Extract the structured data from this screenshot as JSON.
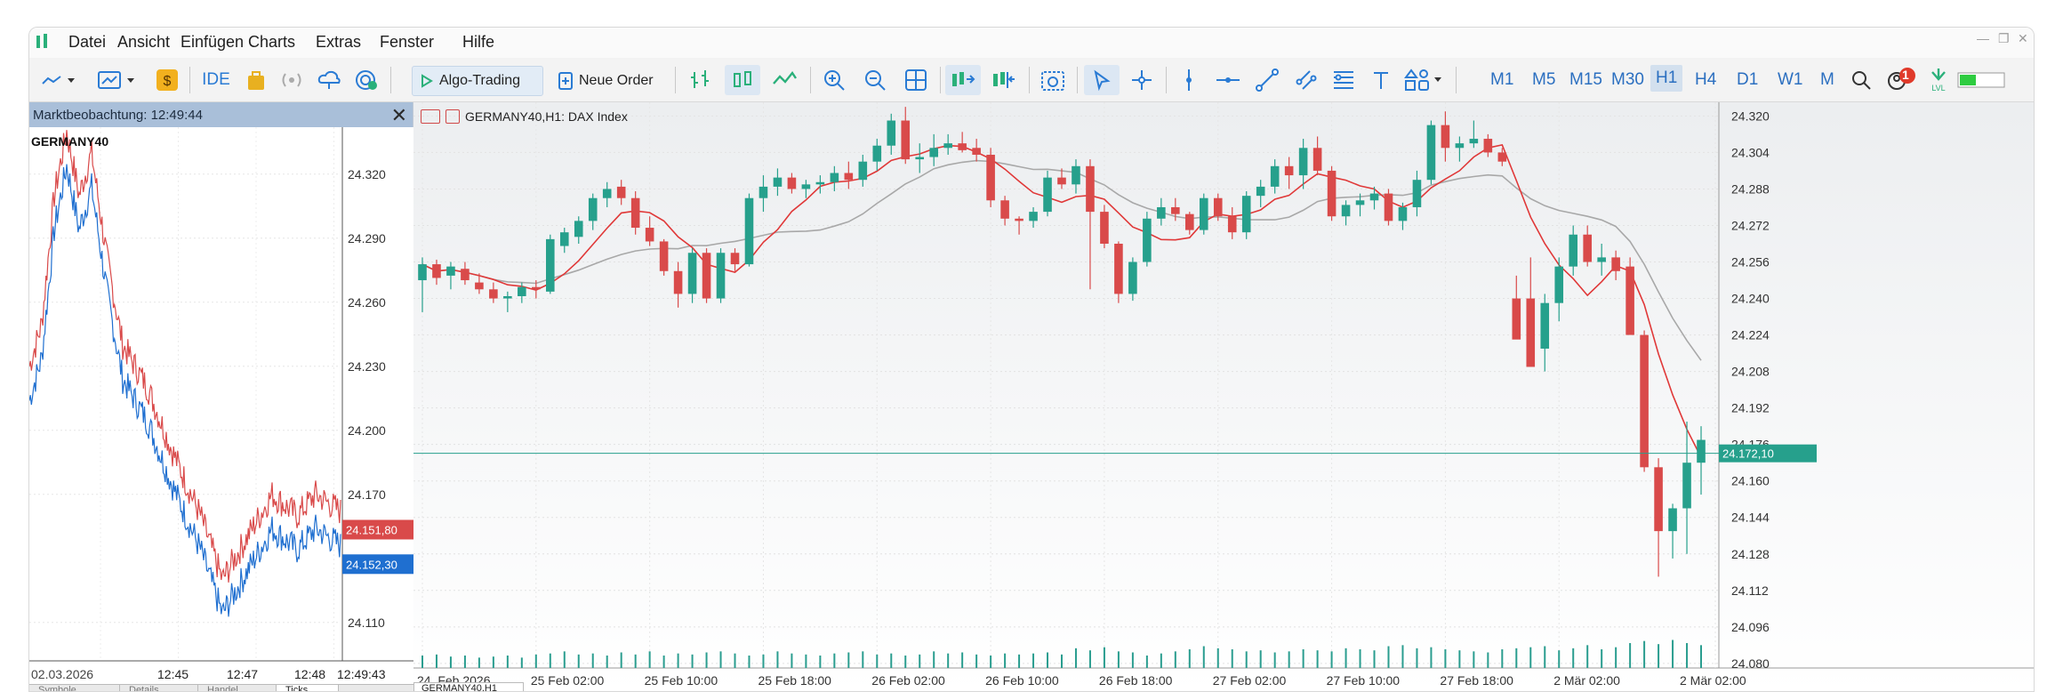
{
  "menu": [
    "Datei",
    "Ansicht",
    "Einfügen",
    "Charts",
    "Extras",
    "Fenster",
    "Hilfe"
  ],
  "toolbar": {
    "ide_label": "IDE",
    "algo_label": "Algo-Trading",
    "order_label": "Neue Order",
    "timeframes": [
      "M1",
      "M5",
      "M15",
      "M30",
      "H1",
      "H4",
      "D1",
      "W1",
      "M"
    ],
    "active_timeframe": "H1",
    "notification_count": "1"
  },
  "market_watch": {
    "title": "Marktbeobachtung: 12:49:44",
    "symbol": "GERMANY40",
    "price_levels": [
      "24.320",
      "24.290",
      "24.260",
      "24.230",
      "24.200",
      "24.170",
      "24.110"
    ],
    "price_values": [
      24320,
      24290,
      24260,
      24230,
      24200,
      24170,
      24110
    ],
    "bid_label": "24.151,80",
    "ask_label": "24.152,30",
    "bid": 24151.8,
    "ask": 24152.3,
    "time_labels": [
      "02.03.2026",
      "12:45",
      "12:47",
      "12:48",
      "12:49:43"
    ],
    "tabs": [
      "Symbole",
      "Details",
      "Handel",
      "Ticks"
    ],
    "colors": {
      "bid": "#d94a4a",
      "ask": "#1f6fd0"
    }
  },
  "chart": {
    "header": "GERMANY40,H1: DAX Index",
    "current_price_label": "24.172,10",
    "current_price": 24172.1,
    "bottom_tab": "GERMANY40,H1",
    "colors": {
      "bull": "#26a08c",
      "bear": "#d94a4a",
      "ma_fast": "#e03838",
      "ma_slow": "#a8a8a8",
      "volume": "#2a9d8f",
      "price_line": "#26a08c"
    }
  },
  "chart_data": {
    "type": "candlestick",
    "yticks": [
      24320,
      24304,
      24288,
      24272,
      24256,
      24240,
      24224,
      24208,
      24192,
      24176,
      24160,
      24144,
      24128,
      24112,
      24096,
      24080
    ],
    "ytick_labels": [
      "24.320",
      "24.304",
      "24.288",
      "24.272",
      "24.256",
      "24.240",
      "24.224",
      "24.208",
      "24.192",
      "24.176",
      "24.160",
      "24.144",
      "24.128",
      "24.112",
      "24.096",
      "24.080"
    ],
    "ylim": [
      24078,
      24326
    ],
    "xtick_labels": [
      "24. Feb 2026",
      "25 Feb 02:00",
      "25 Feb 10:00",
      "25 Feb 18:00",
      "26 Feb 02:00",
      "26 Feb 10:00",
      "26 Feb 18:00",
      "27 Feb 02:00",
      "27 Feb 10:00",
      "27 Feb 18:00",
      "2 Mär 02:00",
      "2 Mär 02:00"
    ],
    "xtick_index": [
      0,
      8,
      16,
      24,
      32,
      40,
      48,
      56,
      64,
      72,
      80,
      91
    ],
    "candles": [
      [
        24248,
        24258,
        24234,
        24255
      ],
      [
        24255,
        24257,
        24246,
        24249
      ],
      [
        24250,
        24256,
        24244,
        24254
      ],
      [
        24253,
        24256,
        24246,
        24248
      ],
      [
        24247,
        24251,
        24242,
        24244
      ],
      [
        24244,
        24247,
        24238,
        24240
      ],
      [
        24240,
        24243,
        24234,
        24241
      ],
      [
        24241,
        24247,
        24238,
        24245
      ],
      [
        24245,
        24248,
        24240,
        24244
      ],
      [
        24243,
        24268,
        24242,
        24266
      ],
      [
        24263,
        24271,
        24260,
        24269
      ],
      [
        24267,
        24276,
        24264,
        24274
      ],
      [
        24274,
        24286,
        24270,
        24284
      ],
      [
        24284,
        24291,
        24280,
        24288
      ],
      [
        24289,
        24292,
        24281,
        24284
      ],
      [
        24284,
        24287,
        24268,
        24271
      ],
      [
        24271,
        24276,
        24263,
        24265
      ],
      [
        24265,
        24266,
        24250,
        24252
      ],
      [
        24252,
        24256,
        24236,
        24242
      ],
      [
        24242,
        24262,
        24238,
        24260
      ],
      [
        24260,
        24262,
        24238,
        24240
      ],
      [
        24240,
        24262,
        24238,
        24260
      ],
      [
        24260,
        24262,
        24252,
        24255
      ],
      [
        24255,
        24286,
        24254,
        24284
      ],
      [
        24284,
        24294,
        24278,
        24289
      ],
      [
        24289,
        24297,
        24285,
        24293
      ],
      [
        24293,
        24295,
        24286,
        24288
      ],
      [
        24288,
        24292,
        24284,
        24290
      ],
      [
        24290,
        24294,
        24286,
        24291
      ],
      [
        24291,
        24298,
        24287,
        24295
      ],
      [
        24295,
        24300,
        24288,
        24292
      ],
      [
        24292,
        24303,
        24289,
        24300
      ],
      [
        24300,
        24310,
        24296,
        24307
      ],
      [
        24307,
        24321,
        24303,
        24318
      ],
      [
        24318,
        24324,
        24299,
        24301
      ],
      [
        24301,
        24308,
        24295,
        24302
      ],
      [
        24302,
        24312,
        24298,
        24306
      ],
      [
        24306,
        24312,
        24303,
        24308
      ],
      [
        24308,
        24313,
        24304,
        24305
      ],
      [
        24306,
        24310,
        24300,
        24303
      ],
      [
        24303,
        24306,
        24280,
        24283
      ],
      [
        24283,
        24285,
        24272,
        24275
      ],
      [
        24275,
        24276,
        24268,
        24274
      ],
      [
        24274,
        24280,
        24271,
        24278
      ],
      [
        24278,
        24296,
        24276,
        24293
      ],
      [
        24293,
        24297,
        24288,
        24290
      ],
      [
        24290,
        24301,
        24286,
        24298
      ],
      [
        24298,
        24301,
        24244,
        24278
      ],
      [
        24278,
        24281,
        24262,
        24264
      ],
      [
        24264,
        24265,
        24238,
        24242
      ],
      [
        24242,
        24258,
        24239,
        24256
      ],
      [
        24256,
        24278,
        24254,
        24275
      ],
      [
        24275,
        24284,
        24272,
        24280
      ],
      [
        24280,
        24284,
        24274,
        24277
      ],
      [
        24277,
        24278,
        24268,
        24270
      ],
      [
        24270,
        24286,
        24268,
        24284
      ],
      [
        24284,
        24286,
        24274,
        24276
      ],
      [
        24276,
        24280,
        24266,
        24269
      ],
      [
        24269,
        24287,
        24266,
        24285
      ],
      [
        24285,
        24292,
        24280,
        24289
      ],
      [
        24289,
        24301,
        24286,
        24298
      ],
      [
        24298,
        24302,
        24288,
        24294
      ],
      [
        24294,
        24310,
        24288,
        24306
      ],
      [
        24306,
        24311,
        24294,
        24296
      ],
      [
        24296,
        24298,
        24274,
        24276
      ],
      [
        24276,
        24283,
        24272,
        24281
      ],
      [
        24281,
        24286,
        24276,
        24283
      ],
      [
        24283,
        24289,
        24279,
        24286
      ],
      [
        24286,
        24288,
        24272,
        24274
      ],
      [
        24274,
        24282,
        24270,
        24280
      ],
      [
        24280,
        24296,
        24276,
        24292
      ],
      [
        24292,
        24318,
        24290,
        24316
      ],
      [
        24316,
        24322,
        24300,
        24306
      ],
      [
        24306,
        24311,
        24300,
        24308
      ],
      [
        24308,
        24318,
        24306,
        24310
      ],
      [
        24310,
        24312,
        24302,
        24304
      ],
      [
        24304,
        24306,
        24298,
        24300
      ],
      [
        24240,
        24250,
        24232,
        24222
      ],
      [
        24240,
        24258,
        24222,
        24210
      ],
      [
        24218,
        24242,
        24208,
        24238
      ],
      [
        24238,
        24258,
        24230,
        24254
      ],
      [
        24254,
        24272,
        24250,
        24268
      ],
      [
        24268,
        24272,
        24254,
        24256
      ],
      [
        24256,
        24264,
        24250,
        24258
      ],
      [
        24258,
        24261,
        24248,
        24252
      ],
      [
        24254,
        24258,
        24244,
        24224
      ],
      [
        24224,
        24226,
        24164,
        24166
      ],
      [
        24166,
        24170,
        24118,
        24138
      ],
      [
        24138,
        24150,
        24126,
        24148
      ],
      [
        24148,
        24186,
        24128,
        24168
      ],
      [
        24168,
        24184,
        24154,
        24178
      ]
    ],
    "volumes": [
      12,
      13,
      11,
      12,
      10,
      11,
      12,
      10,
      13,
      14,
      16,
      13,
      14,
      12,
      15,
      13,
      16,
      12,
      14,
      13,
      15,
      16,
      14,
      12,
      13,
      16,
      14,
      13,
      12,
      14,
      15,
      16,
      13,
      14,
      12,
      13,
      16,
      14,
      15,
      13,
      12,
      14,
      13,
      14,
      15,
      13,
      19,
      17,
      20,
      16,
      15,
      12,
      14,
      16,
      18,
      21,
      19,
      18,
      16,
      17,
      15,
      16,
      18,
      17,
      16,
      19,
      18,
      17,
      21,
      22,
      19,
      20,
      18,
      17,
      16,
      15,
      18,
      19,
      20,
      21,
      17,
      19,
      22,
      18,
      20,
      24,
      26,
      23,
      27,
      24,
      22
    ]
  }
}
